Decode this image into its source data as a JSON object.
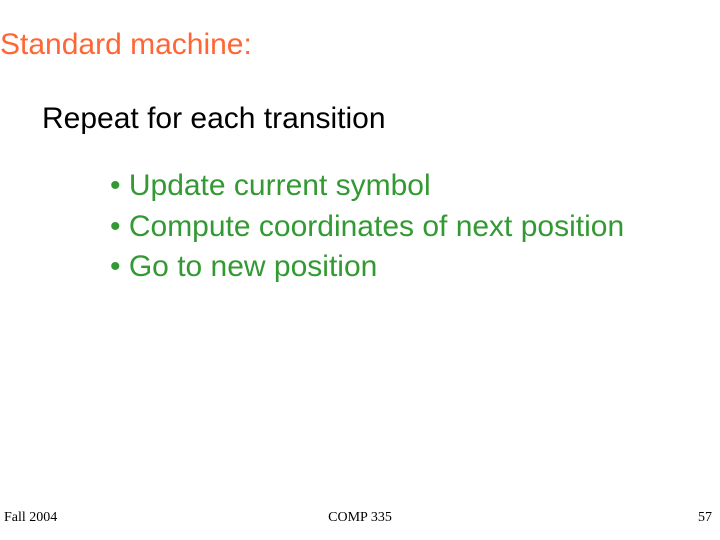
{
  "title": "Standard machine:",
  "subtitle": "Repeat for each transition",
  "bullets": [
    "• Update current symbol",
    "• Compute coordinates of next position",
    "• Go to new position"
  ],
  "footer": {
    "left": "Fall 2004",
    "center": "COMP 335",
    "right": "57"
  }
}
